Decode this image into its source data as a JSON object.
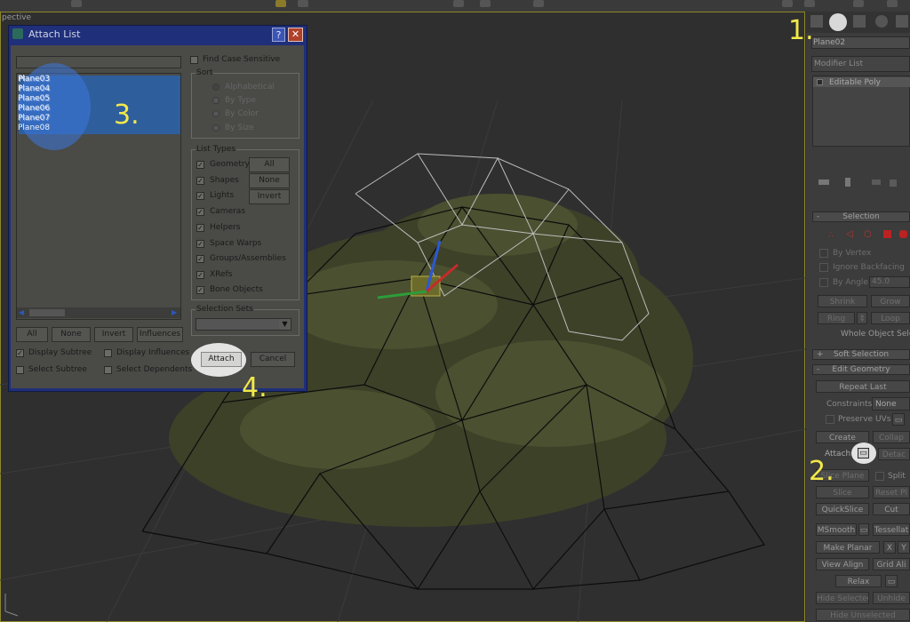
{
  "viewport": {
    "label": "pective"
  },
  "dialog": {
    "title": "Attach List",
    "help_label": "?",
    "close_label": "✕",
    "filter_value": "",
    "items": [
      "Plane03",
      "Plane04",
      "Plane05",
      "Plane06",
      "Plane07",
      "Plane08"
    ],
    "find_case_sensitive": "Find Case Sensitive",
    "sort": {
      "label": "Sort",
      "options": [
        "Alphabetical",
        "By Type",
        "By Color",
        "By Size"
      ]
    },
    "list_types": {
      "label": "List Types",
      "items": [
        "Geometry",
        "Shapes",
        "Lights",
        "Cameras",
        "Helpers",
        "Space Warps",
        "Groups/Assemblies",
        "XRefs",
        "Bone Objects"
      ],
      "all": "All",
      "none": "None",
      "invert": "Invert"
    },
    "selection_sets": {
      "label": "Selection Sets",
      "value": ""
    },
    "bottom_buttons": {
      "all": "All",
      "none": "None",
      "invert": "Invert",
      "influences": "Influences"
    },
    "checks": {
      "display_subtree": "Display Subtree",
      "display_influences": "Display Influences",
      "select_subtree": "Select Subtree",
      "select_dependents": "Select Dependents"
    },
    "attach": "Attach",
    "cancel": "Cancel"
  },
  "panel": {
    "object_name": "Plane02",
    "modifier_list": "Modifier List",
    "stack_item": "Editable Poly",
    "selection": {
      "header": "Selection",
      "by_vertex": "By Vertex",
      "ignore_backfacing": "Ignore Backfacing",
      "by_angle": "By Angle:",
      "angle_value": "45.0",
      "shrink": "Shrink",
      "grow": "Grow",
      "ring": "Ring",
      "loop": "Loop",
      "whole_object": "Whole Object Selec"
    },
    "soft_selection": "Soft Selection",
    "edit_geometry": {
      "header": "Edit Geometry",
      "repeat_last": "Repeat Last",
      "constraints": "Constraints:",
      "constraints_value": "None",
      "preserve_uvs": "Preserve UVs",
      "create": "Create",
      "collapse": "Collap",
      "attach": "Attach",
      "detach": "Detac",
      "slice_plane": "Slice Plane",
      "split": "Split",
      "slice": "Slice",
      "reset_plane": "Reset Pl",
      "quickslice": "QuickSlice",
      "cut": "Cut",
      "msmooth": "MSmooth",
      "tessellate": "Tessellat",
      "make_planar": "Make Planar",
      "x": "X",
      "y": "Y",
      "view_align": "View Align",
      "grid_align": "Grid Ali",
      "relax": "Relax",
      "hide_selected": "Hide Selected",
      "unhide": "Unhide",
      "hide_unselected": "Hide Unselected"
    }
  },
  "steps": {
    "one": "1.",
    "two": "2.",
    "three": "3.",
    "four": "4."
  },
  "colors": {
    "selection": "#2f5e9d",
    "annotation": "#f2e84a",
    "dialog_frame": "#1f2f7a"
  }
}
